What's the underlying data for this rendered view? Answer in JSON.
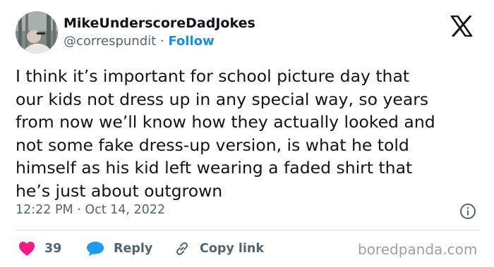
{
  "tweet": {
    "display_name": "MikeUnderscoreDadJokes",
    "handle": "@correspundit",
    "separator": " · ",
    "follow_label": "Follow",
    "text": "I think it’s important for school picture day that\nour kids not dress up in any special way, so years\nfrom now we’ll know how they actually looked and\nnot some fake dress-up version, is what he told\nhimself as his kid left wearing a faded shirt that\nhe’s just about outgrown",
    "timestamp": "12:22 PM · Oct 14, 2022"
  },
  "actions": {
    "like_count": "39",
    "reply_label": "Reply",
    "copy_link_label": "Copy link"
  },
  "icons": {
    "avatar": "avatar-photo",
    "brand": "x-logo-icon",
    "info": "info-icon",
    "like": "heart-icon",
    "reply": "speech-bubble-icon",
    "copy_link": "link-icon"
  },
  "colors": {
    "text": "#0f1419",
    "secondary": "#536471",
    "follow": "#1d8ce0",
    "like": "#f91880",
    "reply": "#1d9bf0",
    "divider": "#d9dee2",
    "watermark": "#9aa0a6"
  },
  "watermark": "boredpanda.com"
}
